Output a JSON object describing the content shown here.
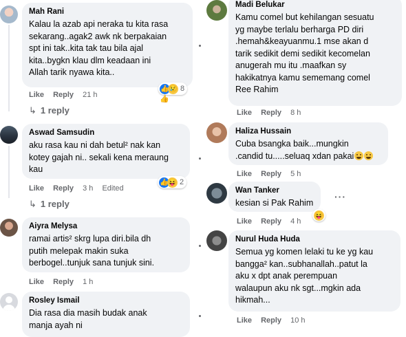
{
  "left_comments": [
    {
      "author": "Mah Rani",
      "text": "Kalau la azab api neraka tu kita rasa\nsekarang..agak2 awk nk berpakaian\nspt ini tak..kita tak tau bila ajal\nkita..bygkn klau dlm keadaan ini\nAllah tarik nyawa kita..",
      "like": "Like",
      "reply": "Reply",
      "time": "21 h",
      "reactions": [
        "like-icon",
        "sad-icon"
      ],
      "reaction_count": "8",
      "replies_link": "1 reply"
    },
    {
      "author": "Aswad Samsudin",
      "text": "aku rasa kau ni dah betul² nak kan\nkotey gajah ni.. sekali kena meraung\nkau",
      "like": "Like",
      "reply": "Reply",
      "time": "3 h",
      "edited": "Edited",
      "reactions": [
        "like-icon",
        "haha-icon"
      ],
      "reaction_count": "2",
      "replies_link": "1 reply"
    },
    {
      "author": "Aiyra Melysa",
      "text": "ramai artis² skrg lupa diri.bila dh\nputih melepak makin suka\nberbogel..tunjuk sana tunjuk sini.",
      "like": "Like",
      "reply": "Reply",
      "time": "1 h"
    },
    {
      "author": "Rosley Ismail",
      "text": "Dia rasa dia masih budak anak\nmanja ayah ni"
    }
  ],
  "right_comments": [
    {
      "author": "Madi Belukar",
      "text": "Kamu comel but kehilangan sesuatu\nyg maybe terlalu berharga PD diri\n.hemah&keayuanmu.1 mse akan d\ntarik sedikit demi sedikit kecomelan\nanugerah mu itu .maafkan sy\nhakikatnya kamu sememang comel\nRee Rahim",
      "like": "Like",
      "reply": "Reply",
      "time": "8 h"
    },
    {
      "author": "Haliza Hussain",
      "text_lines": [
        "Cuba bsangka baik...mungkin",
        ".candid tu.....seluaq xdan pakai"
      ],
      "like": "Like",
      "reply": "Reply",
      "time": "5 h"
    },
    {
      "author": "Wan Tanker",
      "text": "kesian si Pak Rahim",
      "like": "Like",
      "reply": "Reply",
      "time": "4 h",
      "reactions": [
        "haha-icon"
      ]
    },
    {
      "author": "Nurul Huda Huda",
      "text": "Semua yg komen lelaki tu ke yg kau\nbangga² kan..subhanallah..patut la\naku x dpt anak perempuan\nwalaupun aku nk sgt...mgkin ada\nhikmah...",
      "like": "Like",
      "reply": "Reply",
      "time": "10 h"
    }
  ],
  "colors": {
    "bubble": "#f0f2f5",
    "meta_text": "#65676b",
    "like_blue": "#1877f2",
    "emoji_yellow": "#f7c843"
  }
}
